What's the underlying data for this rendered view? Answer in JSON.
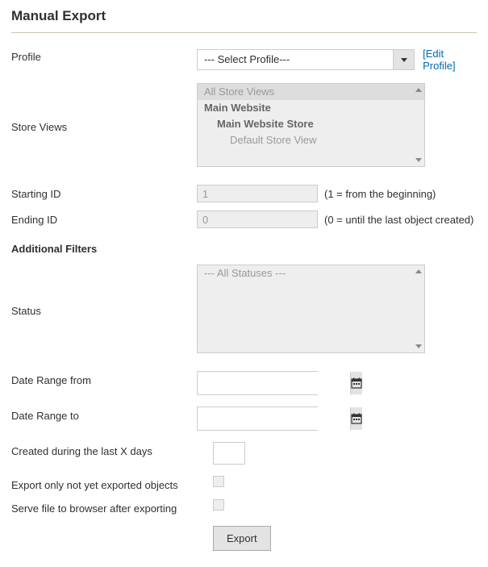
{
  "page": {
    "title": "Manual Export"
  },
  "profile": {
    "label": "Profile",
    "placeholder": "--- Select Profile---",
    "edit_link": "[Edit Profile]"
  },
  "store_views": {
    "label": "Store Views",
    "options": [
      {
        "text": "All Store Views",
        "selected": true,
        "bold": false,
        "indent": 0
      },
      {
        "text": "Main Website",
        "selected": false,
        "bold": true,
        "indent": 0
      },
      {
        "text": "Main Website Store",
        "selected": false,
        "bold": true,
        "indent": 1
      },
      {
        "text": "Default Store View",
        "selected": false,
        "bold": false,
        "indent": 2
      }
    ]
  },
  "starting_id": {
    "label": "Starting ID",
    "value": "1",
    "hint": "(1 = from the beginning)"
  },
  "ending_id": {
    "label": "Ending ID",
    "value": "0",
    "hint": "(0 = until the last object created)"
  },
  "filters": {
    "title": "Additional Filters"
  },
  "status": {
    "label": "Status",
    "options": [
      {
        "text": "--- All Statuses ---",
        "selected": false,
        "bold": false,
        "indent": 0
      }
    ]
  },
  "date_from": {
    "label": "Date Range from",
    "value": ""
  },
  "date_to": {
    "label": "Date Range to",
    "value": ""
  },
  "last_x_days": {
    "label": "Created during the last X days",
    "value": ""
  },
  "not_exported": {
    "label": "Export only not yet exported objects",
    "checked": false
  },
  "serve_file": {
    "label": "Serve file to browser after exporting",
    "checked": false
  },
  "export_btn": {
    "label": "Export"
  }
}
